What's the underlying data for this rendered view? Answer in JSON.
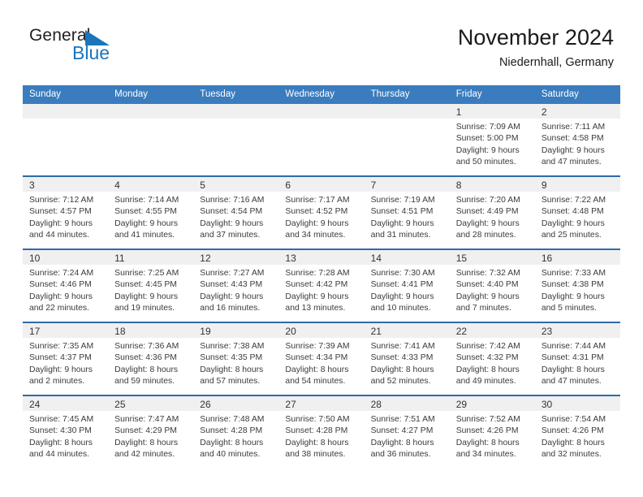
{
  "brand": {
    "name_part1": "General",
    "name_part2": "Blue",
    "color_dark": "#231f20",
    "color_blue": "#1b75bb"
  },
  "header": {
    "title": "November 2024",
    "subtitle": "Niedernhall, Germany"
  },
  "theme": {
    "header_row_bg": "#3a7cbe",
    "header_row_text": "#ffffff",
    "row_separator": "#2e6ba8",
    "daynum_band_bg": "#f0f0f0",
    "body_text": "#3b3b3b"
  },
  "weekdays": [
    "Sunday",
    "Monday",
    "Tuesday",
    "Wednesday",
    "Thursday",
    "Friday",
    "Saturday"
  ],
  "weeks": [
    [
      {
        "day": "",
        "lines": []
      },
      {
        "day": "",
        "lines": []
      },
      {
        "day": "",
        "lines": []
      },
      {
        "day": "",
        "lines": []
      },
      {
        "day": "",
        "lines": []
      },
      {
        "day": "1",
        "lines": [
          "Sunrise: 7:09 AM",
          "Sunset: 5:00 PM",
          "Daylight: 9 hours",
          "and 50 minutes."
        ]
      },
      {
        "day": "2",
        "lines": [
          "Sunrise: 7:11 AM",
          "Sunset: 4:58 PM",
          "Daylight: 9 hours",
          "and 47 minutes."
        ]
      }
    ],
    [
      {
        "day": "3",
        "lines": [
          "Sunrise: 7:12 AM",
          "Sunset: 4:57 PM",
          "Daylight: 9 hours",
          "and 44 minutes."
        ]
      },
      {
        "day": "4",
        "lines": [
          "Sunrise: 7:14 AM",
          "Sunset: 4:55 PM",
          "Daylight: 9 hours",
          "and 41 minutes."
        ]
      },
      {
        "day": "5",
        "lines": [
          "Sunrise: 7:16 AM",
          "Sunset: 4:54 PM",
          "Daylight: 9 hours",
          "and 37 minutes."
        ]
      },
      {
        "day": "6",
        "lines": [
          "Sunrise: 7:17 AM",
          "Sunset: 4:52 PM",
          "Daylight: 9 hours",
          "and 34 minutes."
        ]
      },
      {
        "day": "7",
        "lines": [
          "Sunrise: 7:19 AM",
          "Sunset: 4:51 PM",
          "Daylight: 9 hours",
          "and 31 minutes."
        ]
      },
      {
        "day": "8",
        "lines": [
          "Sunrise: 7:20 AM",
          "Sunset: 4:49 PM",
          "Daylight: 9 hours",
          "and 28 minutes."
        ]
      },
      {
        "day": "9",
        "lines": [
          "Sunrise: 7:22 AM",
          "Sunset: 4:48 PM",
          "Daylight: 9 hours",
          "and 25 minutes."
        ]
      }
    ],
    [
      {
        "day": "10",
        "lines": [
          "Sunrise: 7:24 AM",
          "Sunset: 4:46 PM",
          "Daylight: 9 hours",
          "and 22 minutes."
        ]
      },
      {
        "day": "11",
        "lines": [
          "Sunrise: 7:25 AM",
          "Sunset: 4:45 PM",
          "Daylight: 9 hours",
          "and 19 minutes."
        ]
      },
      {
        "day": "12",
        "lines": [
          "Sunrise: 7:27 AM",
          "Sunset: 4:43 PM",
          "Daylight: 9 hours",
          "and 16 minutes."
        ]
      },
      {
        "day": "13",
        "lines": [
          "Sunrise: 7:28 AM",
          "Sunset: 4:42 PM",
          "Daylight: 9 hours",
          "and 13 minutes."
        ]
      },
      {
        "day": "14",
        "lines": [
          "Sunrise: 7:30 AM",
          "Sunset: 4:41 PM",
          "Daylight: 9 hours",
          "and 10 minutes."
        ]
      },
      {
        "day": "15",
        "lines": [
          "Sunrise: 7:32 AM",
          "Sunset: 4:40 PM",
          "Daylight: 9 hours",
          "and 7 minutes."
        ]
      },
      {
        "day": "16",
        "lines": [
          "Sunrise: 7:33 AM",
          "Sunset: 4:38 PM",
          "Daylight: 9 hours",
          "and 5 minutes."
        ]
      }
    ],
    [
      {
        "day": "17",
        "lines": [
          "Sunrise: 7:35 AM",
          "Sunset: 4:37 PM",
          "Daylight: 9 hours",
          "and 2 minutes."
        ]
      },
      {
        "day": "18",
        "lines": [
          "Sunrise: 7:36 AM",
          "Sunset: 4:36 PM",
          "Daylight: 8 hours",
          "and 59 minutes."
        ]
      },
      {
        "day": "19",
        "lines": [
          "Sunrise: 7:38 AM",
          "Sunset: 4:35 PM",
          "Daylight: 8 hours",
          "and 57 minutes."
        ]
      },
      {
        "day": "20",
        "lines": [
          "Sunrise: 7:39 AM",
          "Sunset: 4:34 PM",
          "Daylight: 8 hours",
          "and 54 minutes."
        ]
      },
      {
        "day": "21",
        "lines": [
          "Sunrise: 7:41 AM",
          "Sunset: 4:33 PM",
          "Daylight: 8 hours",
          "and 52 minutes."
        ]
      },
      {
        "day": "22",
        "lines": [
          "Sunrise: 7:42 AM",
          "Sunset: 4:32 PM",
          "Daylight: 8 hours",
          "and 49 minutes."
        ]
      },
      {
        "day": "23",
        "lines": [
          "Sunrise: 7:44 AM",
          "Sunset: 4:31 PM",
          "Daylight: 8 hours",
          "and 47 minutes."
        ]
      }
    ],
    [
      {
        "day": "24",
        "lines": [
          "Sunrise: 7:45 AM",
          "Sunset: 4:30 PM",
          "Daylight: 8 hours",
          "and 44 minutes."
        ]
      },
      {
        "day": "25",
        "lines": [
          "Sunrise: 7:47 AM",
          "Sunset: 4:29 PM",
          "Daylight: 8 hours",
          "and 42 minutes."
        ]
      },
      {
        "day": "26",
        "lines": [
          "Sunrise: 7:48 AM",
          "Sunset: 4:28 PM",
          "Daylight: 8 hours",
          "and 40 minutes."
        ]
      },
      {
        "day": "27",
        "lines": [
          "Sunrise: 7:50 AM",
          "Sunset: 4:28 PM",
          "Daylight: 8 hours",
          "and 38 minutes."
        ]
      },
      {
        "day": "28",
        "lines": [
          "Sunrise: 7:51 AM",
          "Sunset: 4:27 PM",
          "Daylight: 8 hours",
          "and 36 minutes."
        ]
      },
      {
        "day": "29",
        "lines": [
          "Sunrise: 7:52 AM",
          "Sunset: 4:26 PM",
          "Daylight: 8 hours",
          "and 34 minutes."
        ]
      },
      {
        "day": "30",
        "lines": [
          "Sunrise: 7:54 AM",
          "Sunset: 4:26 PM",
          "Daylight: 8 hours",
          "and 32 minutes."
        ]
      }
    ]
  ]
}
